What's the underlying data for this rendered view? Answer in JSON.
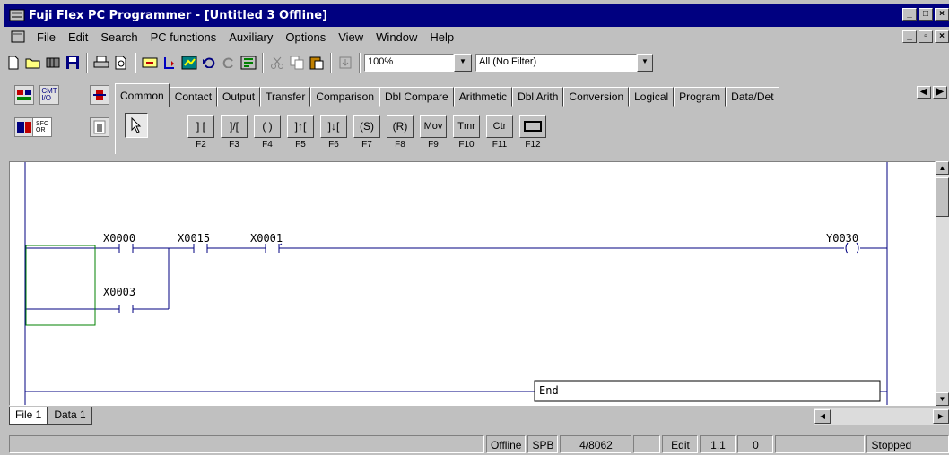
{
  "window": {
    "title": "Fuji Flex PC Programmer - [Untitled 3 Offline]"
  },
  "menu": [
    "File",
    "Edit",
    "Search",
    "PC functions",
    "Auxiliary",
    "Options",
    "View",
    "Window",
    "Help"
  ],
  "toolbar": {
    "zoom_value": "100%",
    "filter_value": "All (No Filter)"
  },
  "tabs": [
    "Common",
    "Contact",
    "Output",
    "Transfer",
    "Comparison",
    "Dbl Compare",
    "Arithmetic",
    "Dbl Arith",
    "Conversion",
    "Logical",
    "Program",
    "Data/Det"
  ],
  "active_tab": "Common",
  "instructions": [
    {
      "label": "] [",
      "key": "F2",
      "icon": "no-contact-icon"
    },
    {
      "label": "]/[",
      "key": "F3",
      "icon": "nc-contact-icon"
    },
    {
      "label": "( )",
      "key": "F4",
      "icon": "coil-icon"
    },
    {
      "label": "]↑[",
      "key": "F5",
      "icon": "rising-edge-icon"
    },
    {
      "label": "]↓[",
      "key": "F6",
      "icon": "falling-edge-icon"
    },
    {
      "label": "(S)",
      "key": "F7",
      "icon": "set-coil-icon"
    },
    {
      "label": "(R)",
      "key": "F8",
      "icon": "reset-coil-icon"
    },
    {
      "label": "Mov",
      "key": "F9",
      "icon": "mov-icon"
    },
    {
      "label": "Tmr",
      "key": "F10",
      "icon": "timer-icon"
    },
    {
      "label": "Ctr",
      "key": "F11",
      "icon": "counter-icon"
    },
    {
      "label": "",
      "key": "F12",
      "icon": "box-icon"
    }
  ],
  "ladder": {
    "contacts": [
      "X0000",
      "X0015",
      "X0001",
      "X0003"
    ],
    "coil": "Y0030",
    "end_label": "End"
  },
  "sheets": [
    "File 1",
    "Data 1"
  ],
  "status": {
    "mode": "Offline",
    "type": "SPB",
    "steps": "4/8062",
    "edit": "Edit",
    "version": "1.1",
    "count": "0",
    "state": "Stopped"
  }
}
